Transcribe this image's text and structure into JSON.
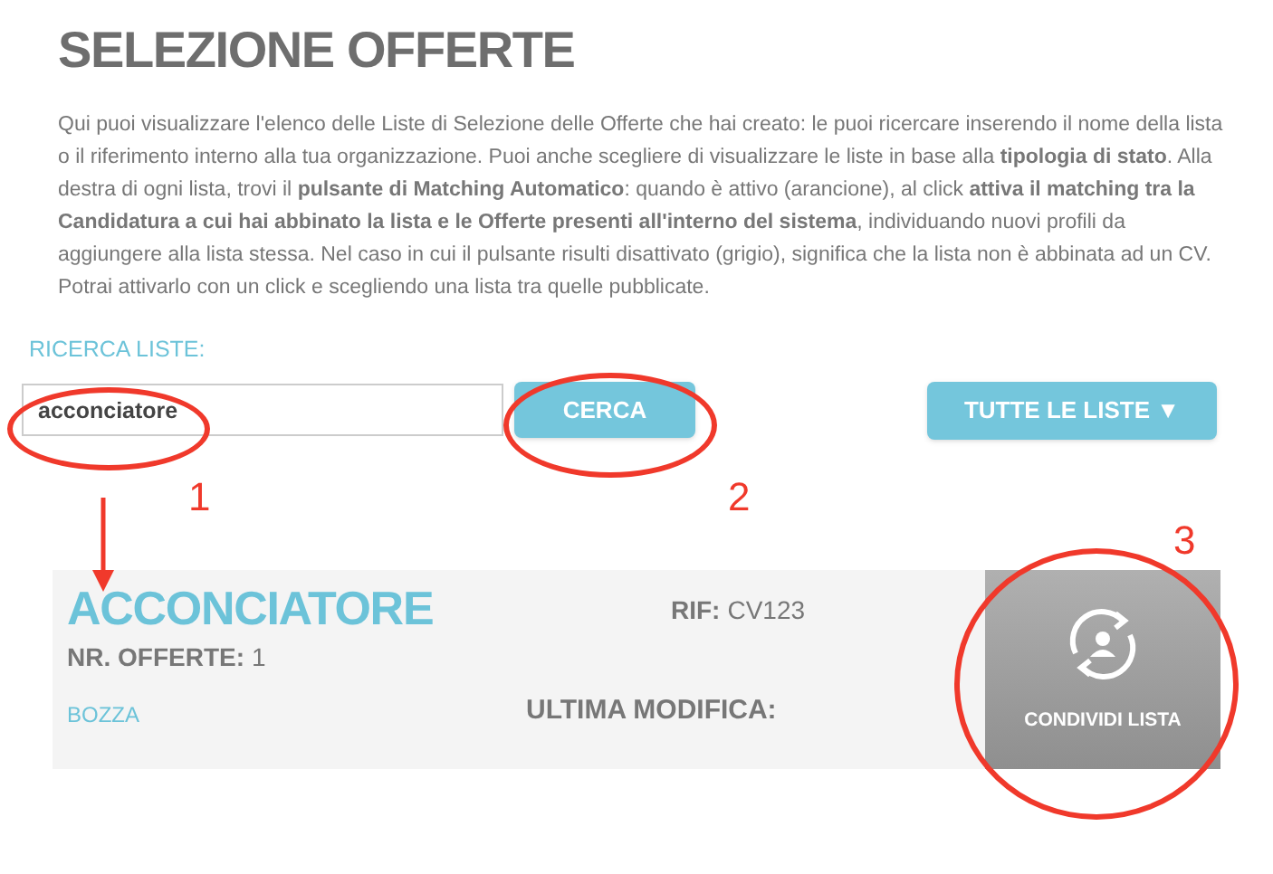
{
  "title": "SELEZIONE OFFERTE",
  "intro": "Qui puoi visualizzare l'elenco delle Liste di Selezione delle Offerte che hai creato: le puoi ricercare inserendo il nome della lista o il riferimento interno alla tua organizzazione. Puoi anche scegliere di visualizzare le liste in base alla **tipologia di stato**. Alla destra di ogni lista, trovi il **pulsante di Matching Automatico**: quando è attivo (arancione), al click **attiva il matching tra la Candidatura a cui hai abbinato la lista e le Offerte presenti all'interno del sistema**, individuando nuovi profili da aggiungere alla lista stessa. Nel caso in cui il pulsante risulti disattivato (grigio), significa che la lista non è abbinata ad un CV. Potrai attivarlo con un click e scegliendo una lista tra quelle pubblicate.",
  "search": {
    "label": "RICERCA LISTE:",
    "value": "acconciatore",
    "button": "CERCA"
  },
  "filter": {
    "label": "TUTTE LE LISTE",
    "caret": "▼"
  },
  "lists": [
    {
      "name": "ACCONCIATORE",
      "offers_label": "NR. OFFERTE:",
      "offers": "1",
      "status": "BOZZA",
      "ref_label": "RIF:",
      "ref": "CV123",
      "modified_label": "ULTIMA MODIFICA:",
      "share": "CONDIVIDI LISTA",
      "matching": false
    }
  ],
  "annotations": [
    "1",
    "2",
    "3"
  ]
}
